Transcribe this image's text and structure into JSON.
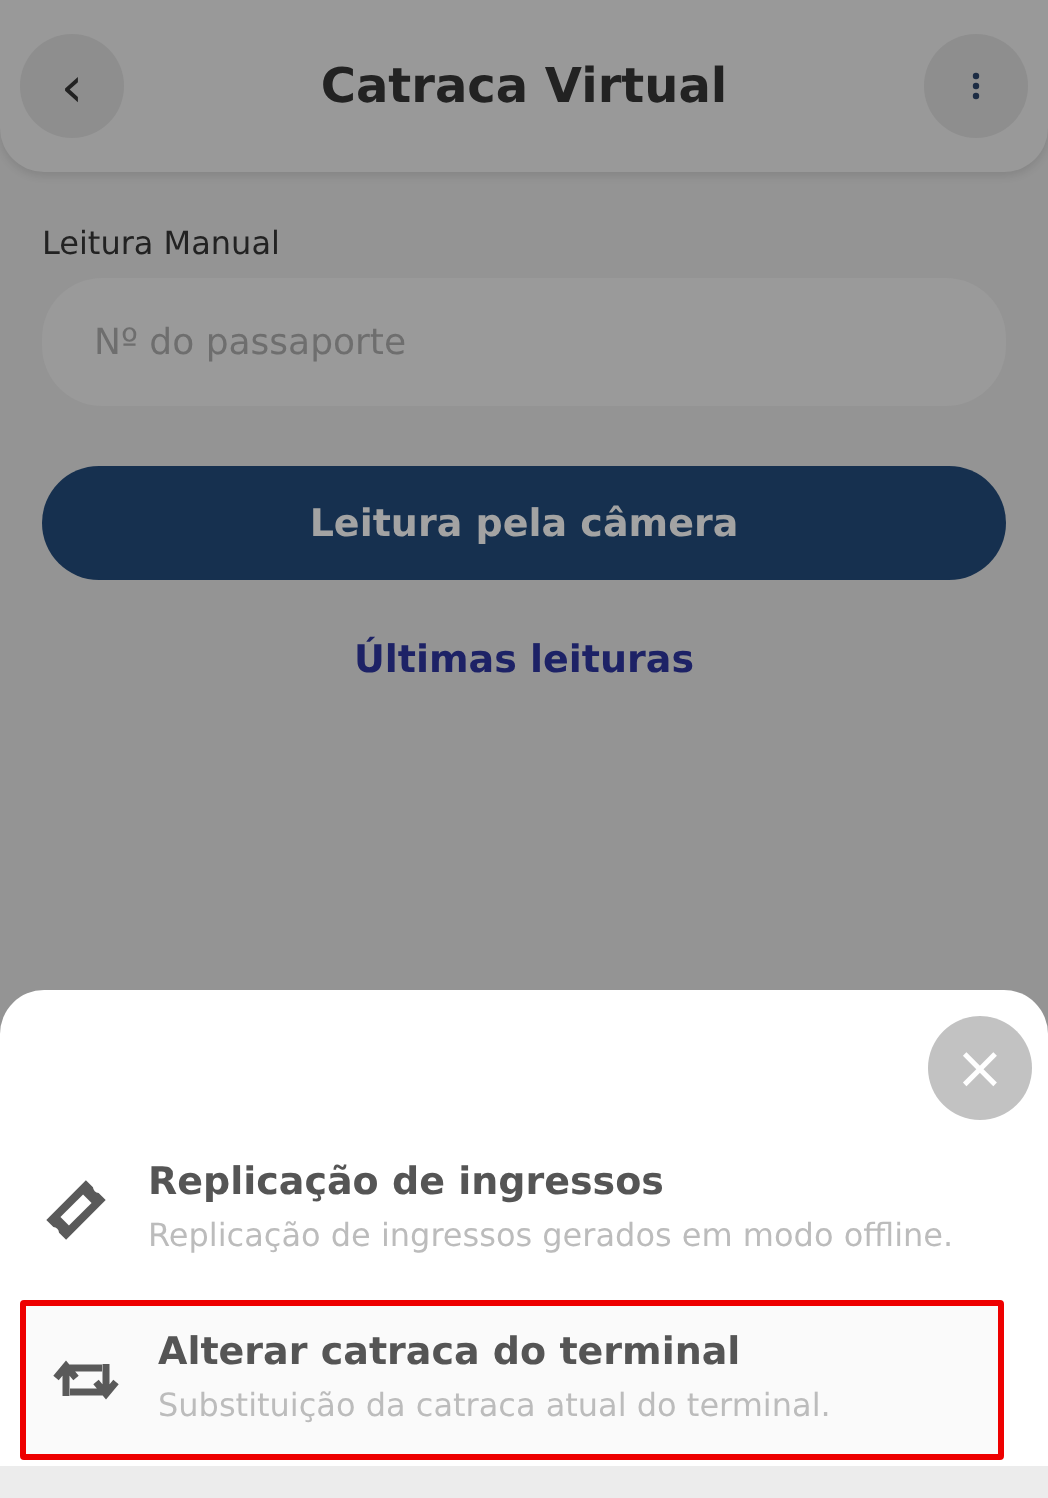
{
  "header": {
    "back": "‹",
    "title": "Catraca Virtual"
  },
  "manual": {
    "label": "Leitura Manual",
    "placeholder": "Nº do passaporte"
  },
  "camera_button": "Leitura pela câmera",
  "recent_link": "Últimas leituras",
  "sheet": {
    "close": "×",
    "items": [
      {
        "kind": "ticket",
        "title": "Replicação de ingressos",
        "description": "Replicação de ingressos gerados em modo offline.",
        "highlighted": false
      },
      {
        "kind": "swap",
        "title": "Alterar catraca do terminal",
        "description": "Substituição da catraca atual do terminal.",
        "highlighted": true
      }
    ]
  }
}
